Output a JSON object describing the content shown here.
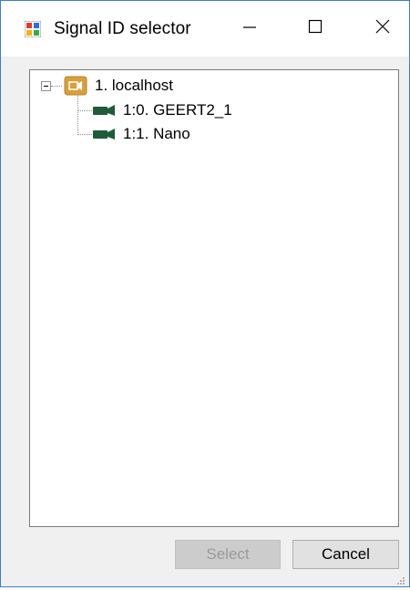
{
  "window": {
    "title": "Signal ID selector",
    "title_icon": "app-icon",
    "controls": [
      "minimize-icon",
      "maximize-icon",
      "close-icon"
    ]
  },
  "tree": {
    "root": {
      "label": "1. localhost",
      "icon": "host-camera-icon",
      "expanded": true,
      "children": [
        {
          "label": "1:0. GEERT2_1",
          "icon": "camera-icon"
        },
        {
          "label": "1:1. Nano",
          "icon": "camera-icon"
        }
      ]
    }
  },
  "buttons": {
    "select_label": "Select",
    "select_enabled": false,
    "cancel_label": "Cancel"
  },
  "colors": {
    "window_border": "#3a7fc4",
    "host_icon": "#d6a13a",
    "camera_icon": "#1f5a3a",
    "disabled_button": "#cccccc"
  }
}
